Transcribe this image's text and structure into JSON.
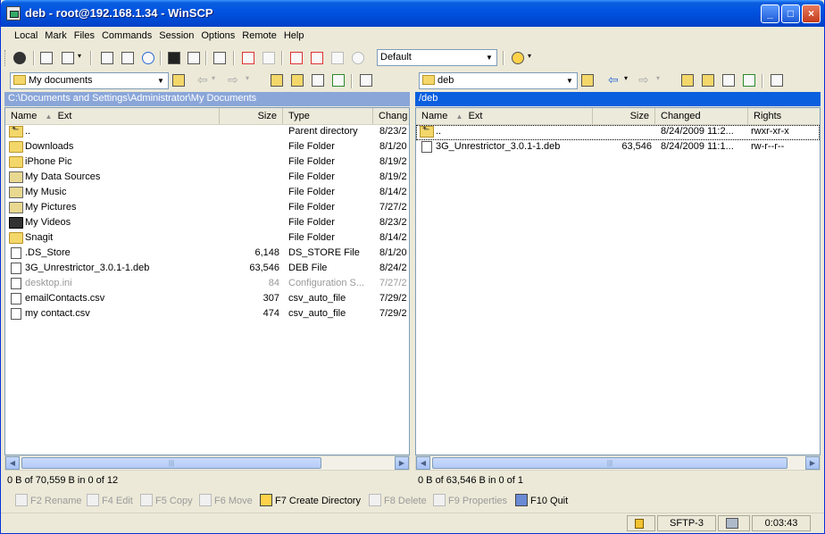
{
  "window": {
    "title": "deb - root@192.168.1.34 - WinSCP"
  },
  "menu": [
    "Local",
    "Mark",
    "Files",
    "Commands",
    "Session",
    "Options",
    "Remote",
    "Help"
  ],
  "toolbar": {
    "profile": "Default"
  },
  "left": {
    "location": "My documents",
    "path": "C:\\Documents and Settings\\Administrator\\My Documents",
    "columns": [
      "Name",
      "Ext",
      "Size",
      "Type",
      "Chang"
    ],
    "files": [
      {
        "name": "..",
        "size": "",
        "type": "Parent directory",
        "changed": "8/23/2",
        "icon": "parent"
      },
      {
        "name": "Downloads",
        "size": "",
        "type": "File Folder",
        "changed": "8/1/20",
        "icon": "folder"
      },
      {
        "name": "iPhone Pic",
        "size": "",
        "type": "File Folder",
        "changed": "8/19/2",
        "icon": "folder"
      },
      {
        "name": "My Data Sources",
        "size": "",
        "type": "File Folder",
        "changed": "8/19/2",
        "icon": "special"
      },
      {
        "name": "My Music",
        "size": "",
        "type": "File Folder",
        "changed": "8/14/2",
        "icon": "special"
      },
      {
        "name": "My Pictures",
        "size": "",
        "type": "File Folder",
        "changed": "7/27/2",
        "icon": "special"
      },
      {
        "name": "My Videos",
        "size": "",
        "type": "File Folder",
        "changed": "8/23/2",
        "icon": "media"
      },
      {
        "name": "Snagit",
        "size": "",
        "type": "File Folder",
        "changed": "8/14/2",
        "icon": "folder"
      },
      {
        "name": ".DS_Store",
        "size": "6,148",
        "type": "DS_STORE File",
        "changed": "8/1/20",
        "icon": "file"
      },
      {
        "name": "3G_Unrestrictor_3.0.1-1.deb",
        "size": "63,546",
        "type": "DEB File",
        "changed": "8/24/2",
        "icon": "file"
      },
      {
        "name": "desktop.ini",
        "size": "84",
        "type": "Configuration S...",
        "changed": "7/27/2",
        "icon": "file",
        "dimmed": true
      },
      {
        "name": "emailContacts.csv",
        "size": "307",
        "type": "csv_auto_file",
        "changed": "7/29/2",
        "icon": "file"
      },
      {
        "name": "my contact.csv",
        "size": "474",
        "type": "csv_auto_file",
        "changed": "7/29/2",
        "icon": "file"
      }
    ],
    "status": "0 B of 70,559 B in 0 of 12"
  },
  "right": {
    "location": "deb",
    "path": "/deb",
    "columns": [
      "Name",
      "Ext",
      "Size",
      "Changed",
      "Rights"
    ],
    "files": [
      {
        "name": "..",
        "size": "",
        "changed": "8/24/2009 11:2...",
        "rights": "rwxr-xr-x",
        "icon": "parent"
      },
      {
        "name": "3G_Unrestrictor_3.0.1-1.deb",
        "size": "63,546",
        "changed": "8/24/2009 11:1...",
        "rights": "rw-r--r--",
        "icon": "file"
      }
    ],
    "status": "0 B of 63,546 B in 0 of 1"
  },
  "fkeys": [
    {
      "label": "F2 Rename",
      "enabled": false
    },
    {
      "label": "F4 Edit",
      "enabled": false
    },
    {
      "label": "F5 Copy",
      "enabled": false
    },
    {
      "label": "F6 Move",
      "enabled": false
    },
    {
      "label": "F7 Create Directory",
      "enabled": true
    },
    {
      "label": "F8 Delete",
      "enabled": false
    },
    {
      "label": "F9 Properties",
      "enabled": false
    },
    {
      "label": "F10 Quit",
      "enabled": true
    }
  ],
  "statusbar": {
    "protocol": "SFTP-3",
    "elapsed": "0:03:43"
  }
}
